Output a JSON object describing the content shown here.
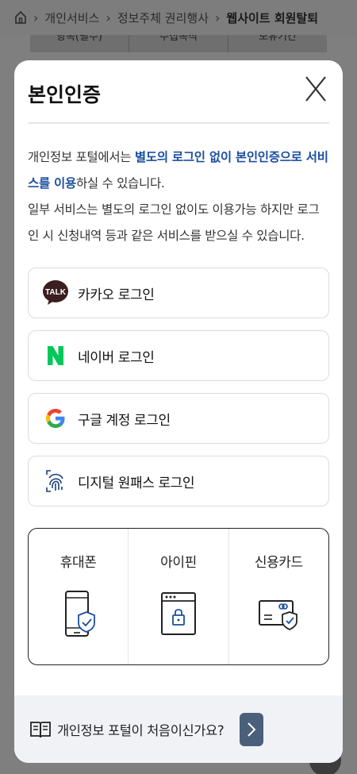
{
  "background": {
    "breadcrumb": [
      "개인서비스",
      "정보주체 권리행사",
      "웹사이트 회원탈퇴"
    ],
    "table_headers": [
      "항목(필수)",
      "수집목적",
      "보유기간"
    ]
  },
  "modal": {
    "title": "본인인증",
    "intro": {
      "p1_a": "개인정보 포털에서는 ",
      "p1_hl": "별도의 로그인 없이 본인인증으로 서비스를 이용",
      "p1_b": "하실 수 있습니다.",
      "p2": "일부 서비스는 별도의 로그인 없이도 이용가능 하지만 로그인 시 신청내역 등과 같은 서비스를 받으실 수 있습니다."
    },
    "logins": [
      {
        "label": "카카오 로그인",
        "icon": "kakao-talk-icon"
      },
      {
        "label": "네이버 로그인",
        "icon": "naver-icon"
      },
      {
        "label": "구글 계정 로그인",
        "icon": "google-icon"
      },
      {
        "label": "디지털 원패스 로그인",
        "icon": "fingerprint-icon"
      }
    ],
    "methods": [
      {
        "label": "휴대폰",
        "icon": "phone-shield-icon"
      },
      {
        "label": "아이핀",
        "icon": "ipin-lock-icon"
      },
      {
        "label": "신용카드",
        "icon": "card-shield-icon"
      }
    ],
    "footer": {
      "label": "개인정보 포털이 처음이신가요?"
    }
  },
  "colors": {
    "accent": "#1c4fa0",
    "kakao": "#3c1e1e",
    "naver": "#03c75a",
    "footer_btn": "#4a5f7a"
  }
}
